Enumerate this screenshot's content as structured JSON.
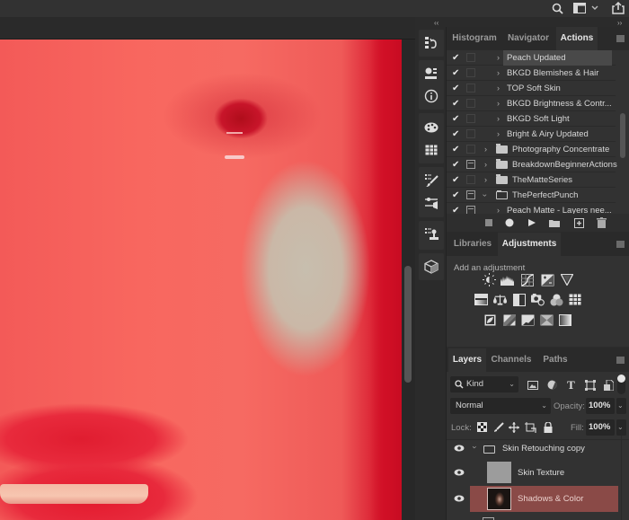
{
  "app": {
    "toolbar_icons": [
      "search-icon",
      "workspace-icon",
      "chevron-down-icon",
      "share-icon"
    ]
  },
  "toolstrip": {
    "icons": [
      "history-icon",
      "properties-icon",
      "info-icon",
      "swatches-icon",
      "grid-icon",
      "brush-presets-icon",
      "brush-settings-icon",
      "clone-source-icon",
      "3d-icon"
    ]
  },
  "actions_panel": {
    "tabs": [
      {
        "label": "Histogram",
        "active": false
      },
      {
        "label": "Navigator",
        "active": false
      },
      {
        "label": "Actions",
        "active": true
      }
    ],
    "rows": [
      {
        "label": "Peach Updated",
        "checked": true,
        "dialog": false,
        "type": "action",
        "expanded": false,
        "selected": true
      },
      {
        "label": "BKGD Blemishes & Hair",
        "checked": true,
        "dialog": false,
        "type": "action",
        "expanded": false,
        "selected": false
      },
      {
        "label": "TOP Soft Skin",
        "checked": true,
        "dialog": false,
        "type": "action",
        "expanded": false,
        "selected": false
      },
      {
        "label": "BKGD Brightness & Contr...",
        "checked": true,
        "dialog": false,
        "type": "action",
        "expanded": false,
        "selected": false
      },
      {
        "label": "BKGD Soft Light",
        "checked": true,
        "dialog": false,
        "type": "action",
        "expanded": false,
        "selected": false
      },
      {
        "label": "Bright & Airy Updated",
        "checked": true,
        "dialog": false,
        "type": "action",
        "expanded": false,
        "selected": false
      },
      {
        "label": "Photography Concentrate",
        "checked": true,
        "dialog": false,
        "type": "set",
        "expanded": false,
        "selected": false
      },
      {
        "label": "BreakdownBeginnerActions",
        "checked": true,
        "dialog": true,
        "type": "set",
        "expanded": false,
        "selected": false
      },
      {
        "label": "TheMatteSeries",
        "checked": true,
        "dialog": false,
        "type": "set",
        "expanded": false,
        "selected": false
      },
      {
        "label": "ThePerfectPunch",
        "checked": true,
        "dialog": true,
        "type": "set",
        "expanded": true,
        "selected": false
      },
      {
        "label": "Peach Matte - Layers nee...",
        "checked": true,
        "dialog": true,
        "type": "action",
        "expanded": false,
        "selected": false
      }
    ],
    "footer_buttons": [
      "stop-icon",
      "record-icon",
      "play-icon",
      "new-set-icon",
      "new-action-icon",
      "delete-icon"
    ]
  },
  "adjustments_panel": {
    "tabs": [
      {
        "label": "Libraries",
        "active": false
      },
      {
        "label": "Adjustments",
        "active": true
      }
    ],
    "hint": "Add an adjustment",
    "icon_rows": [
      [
        "brightness-contrast-icon",
        "levels-icon",
        "curves-icon",
        "exposure-icon",
        "vibrance-icon"
      ],
      [
        "hue-saturation-icon",
        "color-balance-icon",
        "black-white-icon",
        "photo-filter-icon",
        "channel-mixer-icon",
        "color-lookup-icon"
      ],
      [
        "invert-icon",
        "posterize-icon",
        "threshold-icon",
        "selective-color-icon",
        "gradient-map-icon"
      ]
    ]
  },
  "layers_panel": {
    "tabs": [
      {
        "label": "Layers",
        "active": true
      },
      {
        "label": "Channels",
        "active": false
      },
      {
        "label": "Paths",
        "active": false
      }
    ],
    "filter_kind": "Kind",
    "blend_mode": "Normal",
    "opacity_label": "Opacity:",
    "opacity_value": "100%",
    "lock_label": "Lock:",
    "fill_label": "Fill:",
    "fill_value": "100%",
    "layers": [
      {
        "name": "Skin Retouching copy",
        "type": "group",
        "visible": true,
        "expanded": true,
        "selected": false
      },
      {
        "name": "Skin Texture",
        "type": "layer",
        "visible": true,
        "selected": false,
        "thumb": "gray"
      },
      {
        "name": "Shadows & Color",
        "type": "layer",
        "visible": true,
        "selected": true,
        "thumb": "photo"
      }
    ]
  },
  "colors": {
    "accent_selected_layer": "#8a4a47",
    "panel_bg": "#323232",
    "app_bg": "#2b2b2b"
  }
}
